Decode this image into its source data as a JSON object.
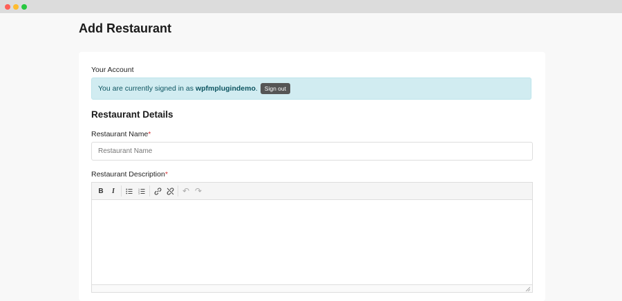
{
  "page": {
    "title": "Add Restaurant"
  },
  "account": {
    "label": "Your Account",
    "notice_prefix": "You are currently signed in as",
    "username": "wpfmplugindemo",
    "sign_out_label": "Sign out"
  },
  "details": {
    "section_title": "Restaurant Details",
    "name_label": "Restaurant Name",
    "name_placeholder": "Restaurant Name",
    "description_label": "Restaurant Description",
    "required_marker": "*"
  },
  "editor": {
    "toolbar": [
      {
        "name": "bold-icon",
        "glyph": "B"
      },
      {
        "name": "italic-icon",
        "glyph": "I"
      },
      {
        "name": "bullet-list-icon",
        "glyph": ""
      },
      {
        "name": "numbered-list-icon",
        "glyph": ""
      },
      {
        "name": "link-icon",
        "glyph": ""
      },
      {
        "name": "unlink-icon",
        "glyph": ""
      },
      {
        "name": "undo-icon",
        "glyph": "↶"
      },
      {
        "name": "redo-icon",
        "glyph": "↷"
      }
    ]
  },
  "colors": {
    "notice_bg": "#d1ecf1",
    "required": "#d63638",
    "sign_out_bg": "#555555"
  }
}
